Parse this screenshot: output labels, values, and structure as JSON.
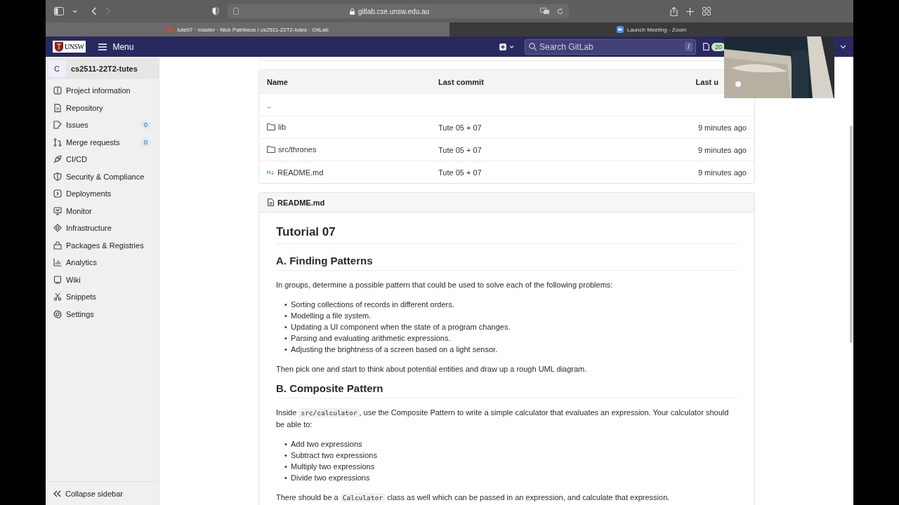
{
  "browser": {
    "url": "gitlab.cse.unsw.edu.au",
    "forward_enabled": false,
    "tabs": [
      {
        "title": "tute07 · master · Nick Patrikeos / cs2511-22T2-tutes · GitLab",
        "selected": true
      },
      {
        "title": "Launch Meeting - Zoom",
        "selected": false
      }
    ]
  },
  "header": {
    "logo_text": "UNSW",
    "menu": "Menu",
    "search_placeholder": "Search GitLab",
    "search_shortcut": "/",
    "issues_count": "20"
  },
  "sidebar": {
    "project_initial": "C",
    "project_name": "cs2511-22T2-tutes",
    "items": [
      {
        "label": "Project information"
      },
      {
        "label": "Repository"
      },
      {
        "label": "Issues",
        "count": "0"
      },
      {
        "label": "Merge requests",
        "count": "0"
      },
      {
        "label": "CI/CD"
      },
      {
        "label": "Security & Compliance"
      },
      {
        "label": "Deployments"
      },
      {
        "label": "Monitor"
      },
      {
        "label": "Infrastructure"
      },
      {
        "label": "Packages & Registries"
      },
      {
        "label": "Analytics"
      },
      {
        "label": "Wiki"
      },
      {
        "label": "Snippets"
      },
      {
        "label": "Settings"
      }
    ],
    "collapse": "Collapse sidebar"
  },
  "files": {
    "columns": [
      "Name",
      "Last commit",
      "Last u"
    ],
    "rows": [
      {
        "kind": "parent",
        "name": ".."
      },
      {
        "kind": "folder",
        "name": "lib",
        "commit": "Tute 05 + 07",
        "updated": "9 minutes ago"
      },
      {
        "kind": "folder",
        "name": "src/thrones",
        "commit": "Tute 05 + 07",
        "updated": "9 minutes ago"
      },
      {
        "kind": "markdown",
        "name": "README.md",
        "commit": "Tute 05 + 07",
        "updated": "9 minutes ago"
      }
    ]
  },
  "readme": {
    "title": "README.md",
    "blocks": [
      {
        "kind": "h1",
        "text": "Tutorial 07"
      },
      {
        "kind": "h2",
        "text": "A. Finding Patterns"
      },
      {
        "kind": "p",
        "parts": [
          {
            "kind": "text",
            "text": "In groups, determine a possible pattern that could be used to solve each of the following problems:"
          }
        ]
      },
      {
        "kind": "ul",
        "bullet": "•",
        "items": [
          "Sorting collections of records in different orders.",
          "Modelling a file system.",
          "Updating a UI component when the state of a program changes.",
          "Parsing and evaluating arithmetic expressions.",
          "Adjusting the brightness of a screen based on a light sensor."
        ]
      },
      {
        "kind": "p",
        "parts": [
          {
            "kind": "text",
            "text": "Then pick one and start to think about potential entities and draw up a rough UML diagram."
          }
        ]
      },
      {
        "kind": "h2",
        "text": "B. Composite Pattern"
      },
      {
        "kind": "p",
        "parts": [
          {
            "kind": "text",
            "text": "Inside "
          },
          {
            "kind": "code",
            "text": "src/calculator"
          },
          {
            "kind": "text",
            "text": ", use the Composite Pattern to write a simple calculator that evaluates an expression. Your calculator should be able to:"
          }
        ]
      },
      {
        "kind": "ul",
        "bullet": "•",
        "items": [
          "Add two expressions",
          "Subtract two expressions",
          "Multiply two expressions",
          "Divide two expressions"
        ]
      },
      {
        "kind": "p",
        "parts": [
          {
            "kind": "text",
            "text": "There should be a "
          },
          {
            "kind": "code",
            "text": "Calculator"
          },
          {
            "kind": "text",
            "text": " class as well which can be passed in an expression, and calculate that expression."
          }
        ]
      }
    ]
  }
}
